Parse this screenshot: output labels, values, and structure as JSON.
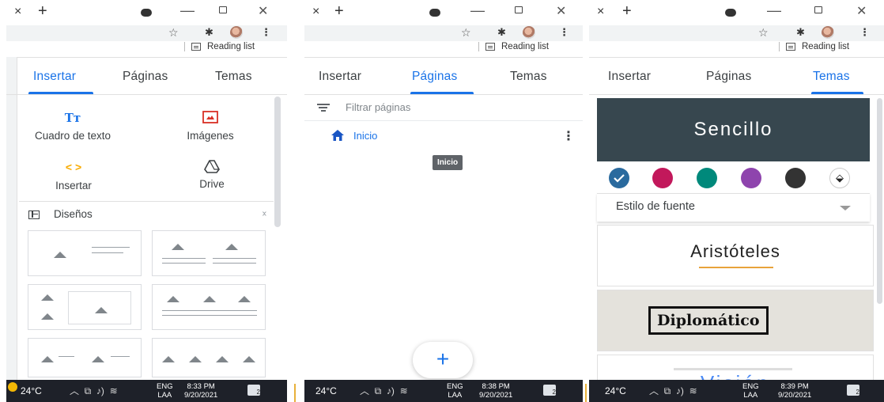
{
  "browser": {
    "close_tab": "×",
    "new_tab": "+",
    "minimize": "—",
    "close_window": "✕",
    "star": "☆",
    "kebab": "⋮",
    "reading_list": "Reading list"
  },
  "sidebar": {
    "tabs": [
      "Insertar",
      "Páginas",
      "Temas"
    ]
  },
  "insert_panel": {
    "text_box": "Cuadro de texto",
    "text_box_icon": "Tт",
    "images": "Imágenes",
    "embed": "Insertar",
    "embed_icon": "< >",
    "drive": "Drive",
    "layouts": "Diseños"
  },
  "pages_panel": {
    "filter_placeholder": "Filtrar páginas",
    "page_name": "Inicio",
    "tooltip": "Inicio",
    "add_button": "+"
  },
  "themes_panel": {
    "selected_theme": "Sencillo",
    "swatch_colors": [
      "#2a6a9e",
      "#c2185b",
      "#00897b",
      "#8e44ad",
      "#333333"
    ],
    "font_style": "Estilo de fuente",
    "theme_aristoteles": "Aristóteles",
    "theme_diplomatico": "Diplomático",
    "theme_vision": "Visión"
  },
  "taskbars": [
    {
      "temp": "24°C",
      "lang1": "ENG",
      "lang2": "LAA",
      "time": "8:33 PM",
      "date": "9/20/2021",
      "notif": "2"
    },
    {
      "temp": "24°C",
      "lang1": "ENG",
      "lang2": "LAA",
      "time": "8:38 PM",
      "date": "9/20/2021",
      "notif": "2"
    },
    {
      "temp": "24°C",
      "lang1": "ENG",
      "lang2": "LAA",
      "time": "8:39 PM",
      "date": "9/20/2021",
      "notif": "2"
    }
  ]
}
